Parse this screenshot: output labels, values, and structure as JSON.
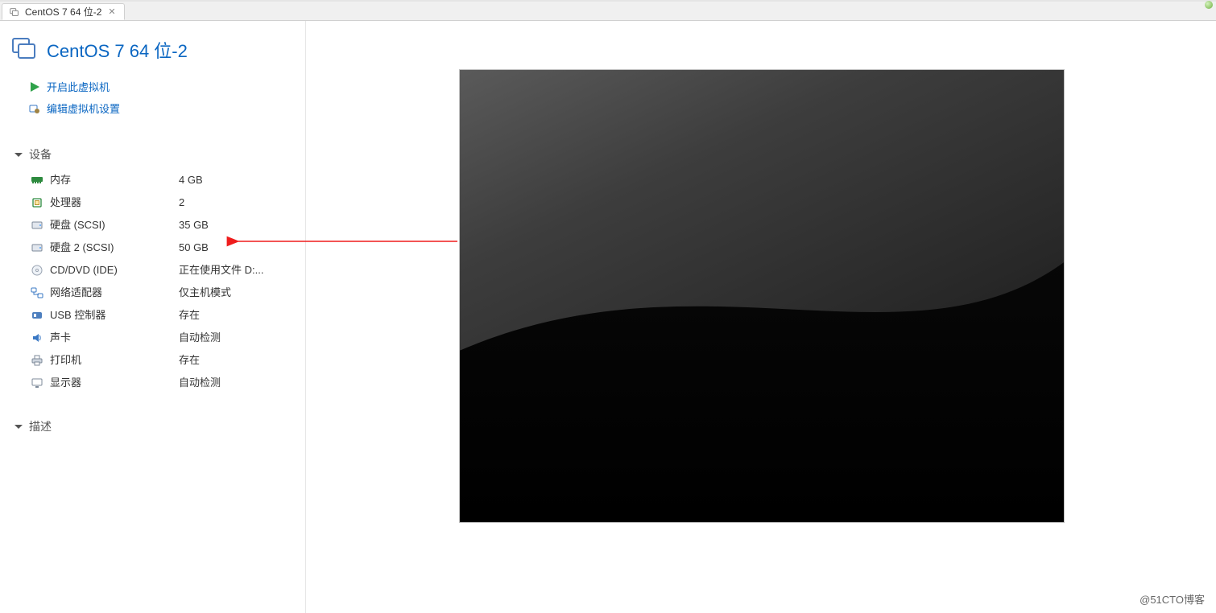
{
  "tab": {
    "label": "CentOS 7 64 位-2"
  },
  "vm": {
    "title": "CentOS 7 64 位-2"
  },
  "actions": {
    "power_on": "开启此虚拟机",
    "edit_settings": "编辑虚拟机设置"
  },
  "sections": {
    "devices_header": "设备",
    "description_header": "描述"
  },
  "devices": [
    {
      "label": "内存",
      "value": "4 GB",
      "icon": "memory"
    },
    {
      "label": "处理器",
      "value": "2",
      "icon": "cpu"
    },
    {
      "label": "硬盘 (SCSI)",
      "value": "35 GB",
      "icon": "disk"
    },
    {
      "label": "硬盘 2 (SCSI)",
      "value": "50 GB",
      "icon": "disk"
    },
    {
      "label": "CD/DVD (IDE)",
      "value": "正在使用文件 D:...",
      "icon": "cd"
    },
    {
      "label": "网络适配器",
      "value": "仅主机模式",
      "icon": "network"
    },
    {
      "label": "USB 控制器",
      "value": "存在",
      "icon": "usb"
    },
    {
      "label": "声卡",
      "value": "自动检测",
      "icon": "sound"
    },
    {
      "label": "打印机",
      "value": "存在",
      "icon": "printer"
    },
    {
      "label": "显示器",
      "value": "自动检测",
      "icon": "display"
    }
  ],
  "watermark": "@51CTO博客"
}
